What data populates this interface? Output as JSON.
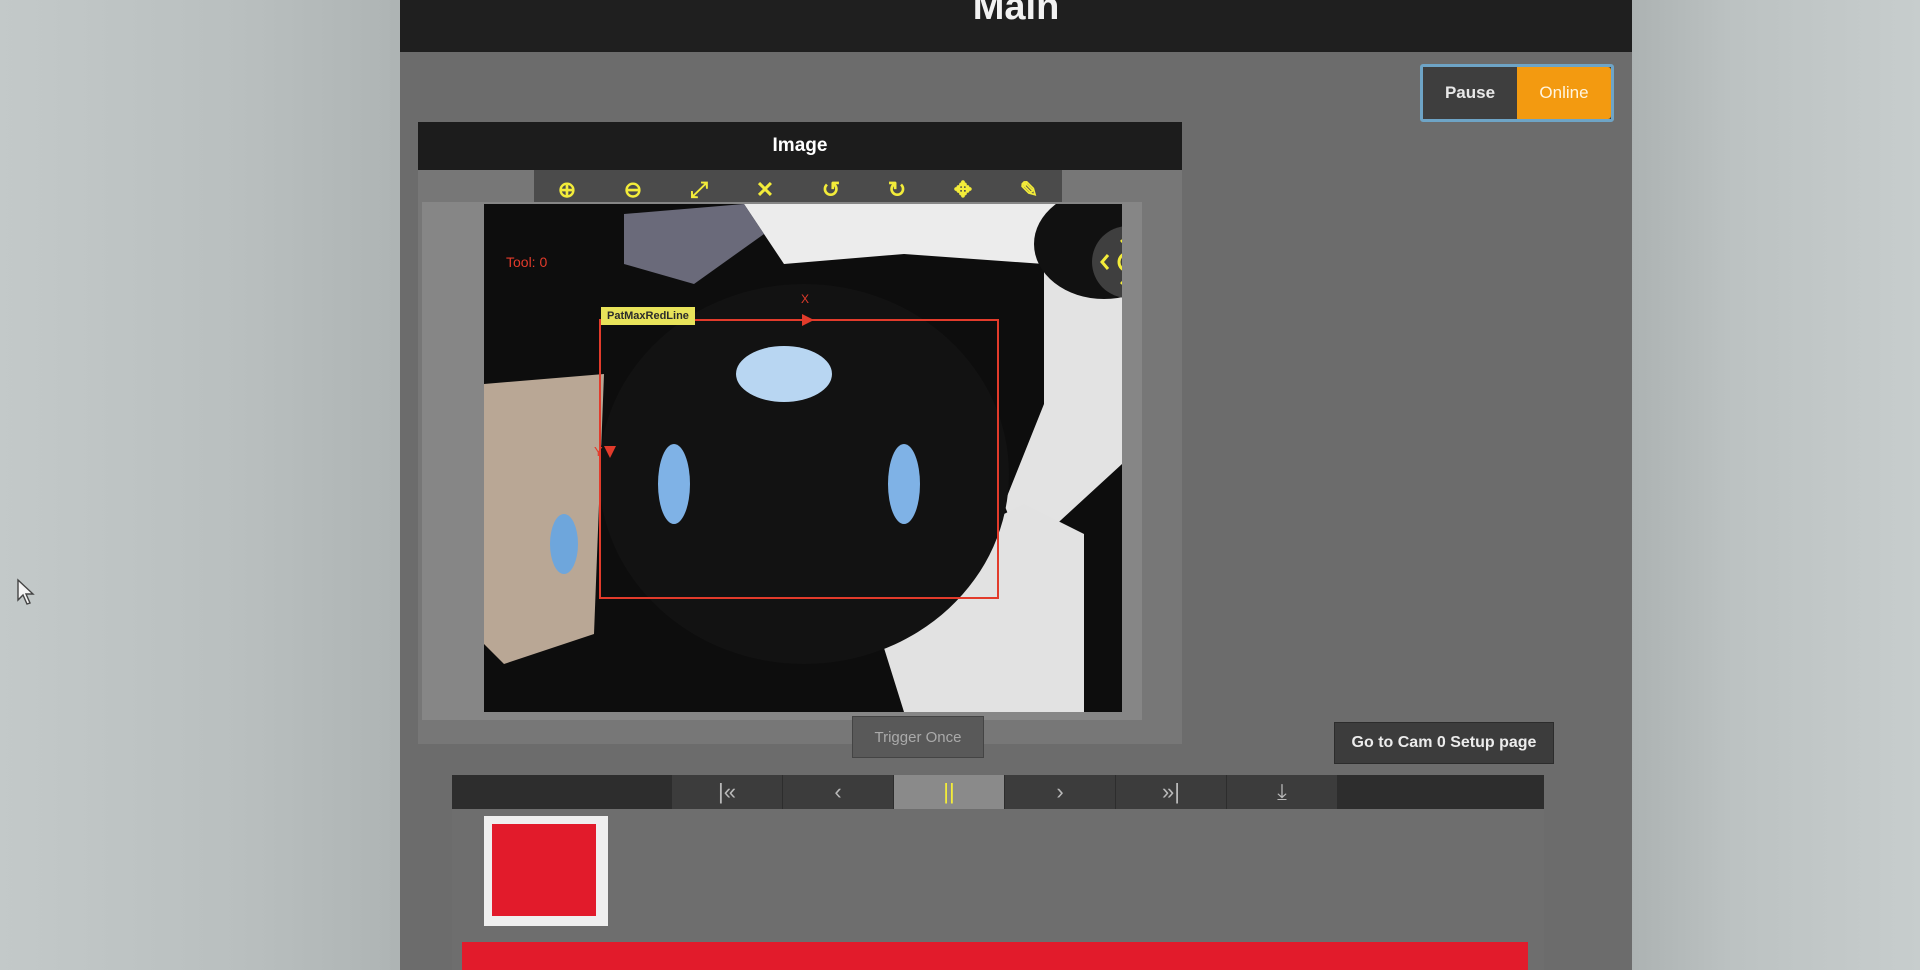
{
  "app": {
    "title": "Main"
  },
  "mode_toggle": {
    "pause_label": "Pause",
    "online_label": "Online",
    "active": "Online"
  },
  "image_panel": {
    "title": "Image",
    "toolbar": [
      {
        "name": "zoom-in-icon",
        "glyph": "⊕"
      },
      {
        "name": "zoom-out-icon",
        "glyph": "⊖"
      },
      {
        "name": "fit-diagonal-icon",
        "glyph": "⤢"
      },
      {
        "name": "expand-icon",
        "glyph": "✕"
      },
      {
        "name": "rotate-left-icon",
        "glyph": "↺"
      },
      {
        "name": "rotate-right-icon",
        "glyph": "↻"
      },
      {
        "name": "center-icon",
        "glyph": "✥"
      },
      {
        "name": "pin-icon",
        "glyph": "✎"
      }
    ],
    "overlay": {
      "tool_label": "Tool: 0",
      "roi_label": "PatMaxRedLine",
      "axis_x": "X",
      "axis_y": "Y"
    },
    "nav_pad": "pan-control"
  },
  "buttons": {
    "trigger_once": "Trigger Once",
    "setup_page": "Go to Cam 0 Setup page"
  },
  "history": {
    "buttons": [
      {
        "name": "first-icon",
        "glyph": "|«"
      },
      {
        "name": "previous-icon",
        "glyph": "‹"
      },
      {
        "name": "pause-icon",
        "glyph": "||"
      },
      {
        "name": "next-icon",
        "glyph": "›"
      },
      {
        "name": "last-icon",
        "glyph": "»|"
      },
      {
        "name": "download-icon",
        "glyph": "⤓"
      }
    ],
    "active_index": 2
  },
  "result": {
    "status": "fail",
    "color": "#e21b2b"
  },
  "colors": {
    "accent": "#f39a10",
    "toolbar_icon": "#f3ec3a",
    "fail": "#e21b2b",
    "roi": "#e23b2b"
  }
}
